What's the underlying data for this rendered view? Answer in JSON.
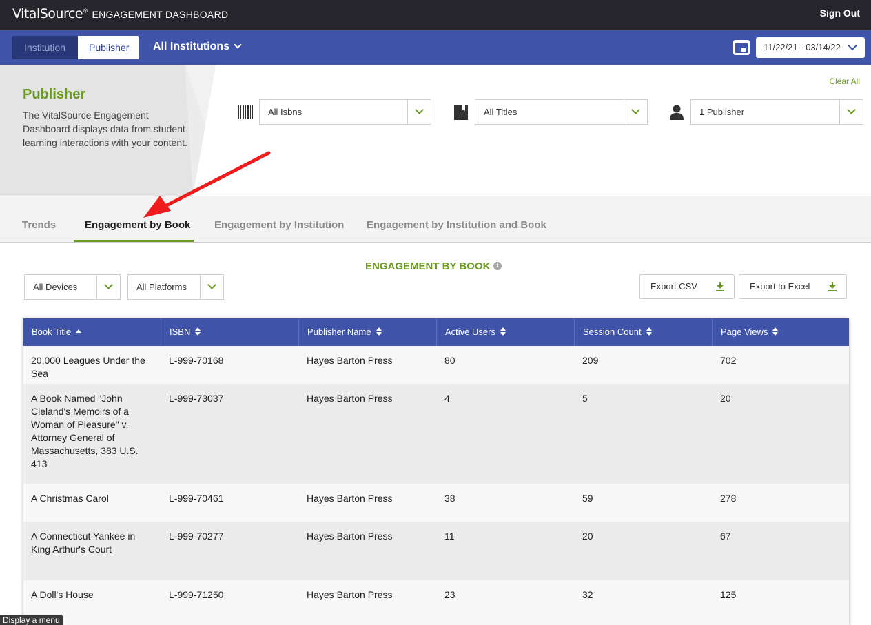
{
  "app": {
    "logo": "VitalSource",
    "logo_mark": "®",
    "dashboard_title": "ENGAGEMENT DASHBOARD",
    "sign_out": "Sign Out"
  },
  "nav": {
    "toggle": [
      "Institution",
      "Publisher"
    ],
    "active_toggle": "Publisher",
    "institution_select": "All Institutions",
    "date_range": "11/22/21 - 03/14/22"
  },
  "hero": {
    "title": "Publisher",
    "description": "The VitalSource Engagement Dashboard displays data from student learning interactions with your content."
  },
  "filters": {
    "clear_all": "Clear All",
    "isbn": "All Isbns",
    "titles": "All Titles",
    "publisher": "1 Publisher"
  },
  "tabs": [
    "Trends",
    "Engagement by Book",
    "Engagement by Institution",
    "Engagement by Institution and Book"
  ],
  "active_tab": "Engagement by Book",
  "section": {
    "title": "ENGAGEMENT BY BOOK",
    "info": "i",
    "devices": "All Devices",
    "platforms": "All Platforms",
    "export_csv": "Export CSV",
    "export_excel": "Export to Excel"
  },
  "table": {
    "headers": [
      "Book Title",
      "ISBN",
      "Publisher Name",
      "Active Users",
      "Session Count",
      "Page Views"
    ],
    "rows": [
      [
        "20,000 Leagues Under the Sea",
        "L-999-70168",
        "Hayes Barton Press",
        "80",
        "209",
        "702"
      ],
      [
        "A Book Named \"John Cleland's Memoirs of a Woman of Pleasure\" v. Attorney General of Massachusetts, 383 U.S. 413",
        "L-999-73037",
        "Hayes Barton Press",
        "4",
        "5",
        "20"
      ],
      [
        "A Christmas Carol",
        "L-999-70461",
        "Hayes Barton Press",
        "38",
        "59",
        "278"
      ],
      [
        "A Connecticut Yankee in King Arthur's Court",
        "L-999-70277",
        "Hayes Barton Press",
        "11",
        "20",
        "67"
      ],
      [
        "A Doll's House",
        "L-999-71250",
        "Hayes Barton Press",
        "23",
        "32",
        "125"
      ]
    ]
  },
  "tooltip": "Display a menu",
  "colors": {
    "topbar": "#26252b",
    "nav_blue": "#3f54a8",
    "accent_green": "#6a9a1f",
    "annotation_red": "#ee1c1c"
  }
}
